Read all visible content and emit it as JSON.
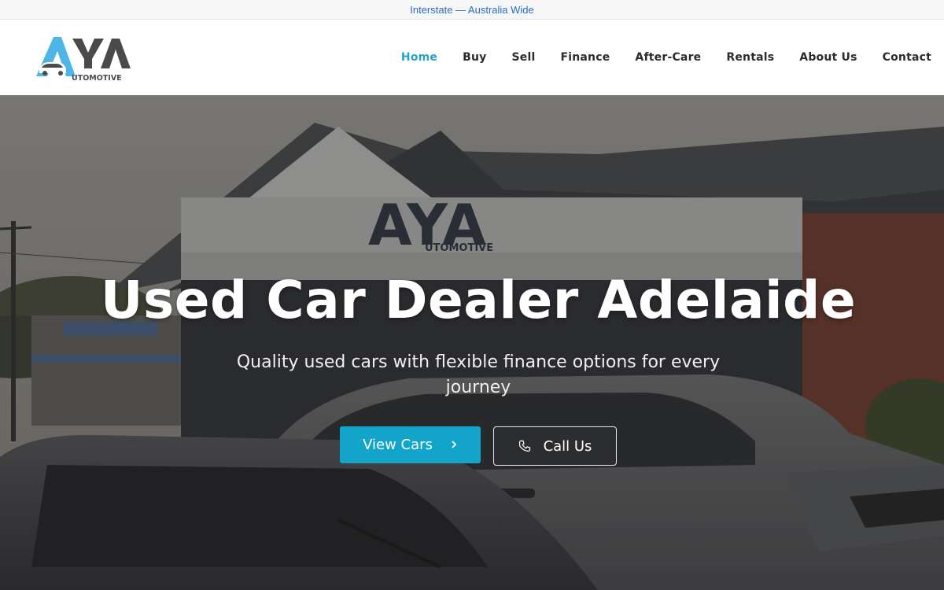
{
  "topbar": {
    "text": "Interstate — Australia Wide"
  },
  "brand": {
    "logo_text": "AYA",
    "logo_subtext": "UTOMOTIVE",
    "accent_color": "#2aa3c8",
    "logo_blue": "#4db6e6",
    "logo_gray": "#4a4a4a"
  },
  "nav": {
    "items": [
      {
        "label": "Home",
        "active": true
      },
      {
        "label": "Buy"
      },
      {
        "label": "Sell"
      },
      {
        "label": "Finance"
      },
      {
        "label": "After-Care"
      },
      {
        "label": "Rentals"
      },
      {
        "label": "About Us"
      },
      {
        "label": "Contact"
      }
    ]
  },
  "hero": {
    "title": "Used Car Dealer Adelaide",
    "subtitle": "Quality used cars with flexible finance options for every journey",
    "sign_text": "AYA",
    "sign_subtext": "UTOMOTIVE",
    "primary_button": {
      "label": "View Cars",
      "icon": "chevron-right-icon",
      "color": "#12a5c9"
    },
    "secondary_button": {
      "label": "Call Us",
      "icon": "phone-icon"
    }
  }
}
